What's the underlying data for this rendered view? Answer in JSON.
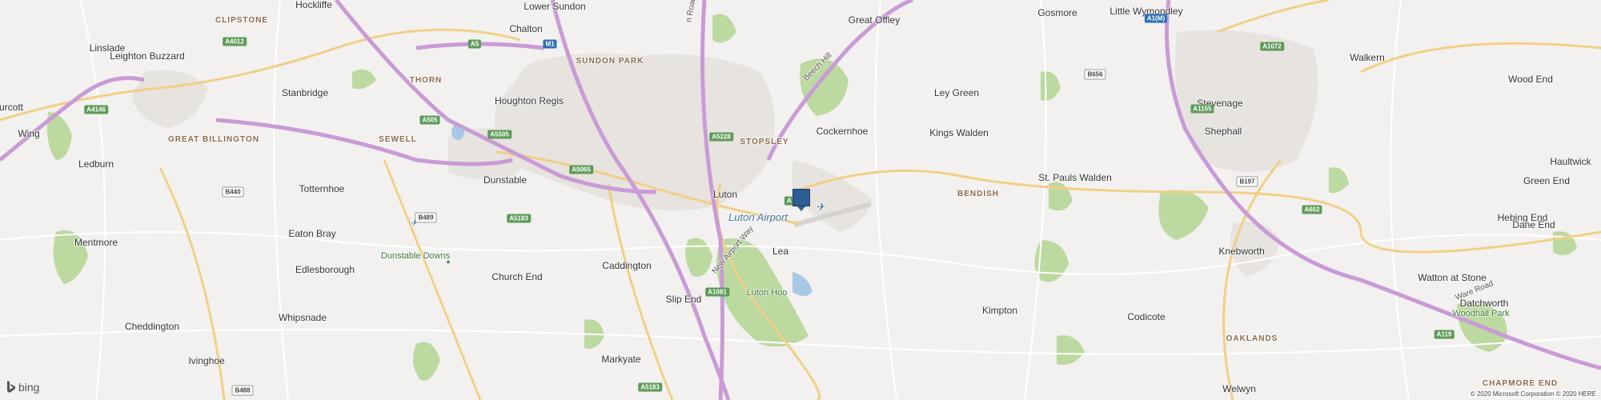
{
  "map": {
    "attribution": "© 2020 Microsoft Corporation © 2020 HERE",
    "brand": "bing",
    "colors": {
      "background": "#f2f1ef",
      "motorway": "#c99bd6",
      "a_road": "#f3d58d",
      "minor_road": "#ffffff",
      "urban": "#e6e2de",
      "woodland": "#b7d79a",
      "water": "#a9c8e8",
      "pin": "#2d5d94"
    },
    "pin_icon": "location-marker",
    "place_labels": [
      {
        "text": "Hockliffe"
      },
      {
        "text": "Lower Sundon"
      },
      {
        "text": "Great Offley"
      },
      {
        "text": "Gosmore"
      },
      {
        "text": "Little Wymondley"
      },
      {
        "text": "Linslade"
      },
      {
        "text": "Leighton Buzzard"
      },
      {
        "text": "Chalton"
      },
      {
        "text": "Stanbridge"
      },
      {
        "text": "Houghton Regis"
      },
      {
        "text": "Ley Green"
      },
      {
        "text": "Walkern"
      },
      {
        "text": "Wood End"
      },
      {
        "text": "urcott"
      },
      {
        "text": "Wing"
      },
      {
        "text": "Cockernhoe"
      },
      {
        "text": "Kings Walden"
      },
      {
        "text": "Stevenage"
      },
      {
        "text": "Shephall"
      },
      {
        "text": "Haultwick"
      },
      {
        "text": "Ledburn"
      },
      {
        "text": "Totternhoe"
      },
      {
        "text": "Dunstable"
      },
      {
        "text": "Luton"
      },
      {
        "text": "St. Pauls Walden"
      },
      {
        "text": "Green End"
      },
      {
        "text": "Eaton Bray"
      },
      {
        "text": "Hebing End"
      },
      {
        "text": "Dane End"
      },
      {
        "text": "Mentmore"
      },
      {
        "text": "Caddington"
      },
      {
        "text": "Lea"
      },
      {
        "text": "Knebworth"
      },
      {
        "text": "Edlesborough"
      },
      {
        "text": "Church End"
      },
      {
        "text": "Slip End"
      },
      {
        "text": "Watton at Stone"
      },
      {
        "text": "Datchworth"
      },
      {
        "text": "Kimpton"
      },
      {
        "text": "Codicote"
      },
      {
        "text": "Whipsnade"
      },
      {
        "text": "Cheddington"
      },
      {
        "text": "Markyate"
      },
      {
        "text": "Ivinghoe"
      },
      {
        "text": "Welwyn"
      }
    ],
    "district_labels": [
      {
        "text": "CLIPSTONE"
      },
      {
        "text": "SUNDON PARK"
      },
      {
        "text": "THORN"
      },
      {
        "text": "STOPSLEY"
      },
      {
        "text": "GREAT BILLINGTON"
      },
      {
        "text": "SEWELL"
      },
      {
        "text": "BENDISH"
      },
      {
        "text": "OAKLANDS"
      },
      {
        "text": "CHAPMORE END"
      }
    ],
    "green_labels": [
      {
        "text": "Dunstable Downs"
      },
      {
        "text": "Luton Hoo"
      },
      {
        "text": "Woodhall Park"
      }
    ],
    "airport_label": "Luton Airport",
    "road_labels": [
      {
        "text": "Beech Hill"
      },
      {
        "text": "New Airport Way"
      },
      {
        "text": "Ware Road"
      },
      {
        "text": "n Road"
      }
    ],
    "road_shields": [
      {
        "text": "A4012",
        "style": "green"
      },
      {
        "text": "A5",
        "style": "green"
      },
      {
        "text": "M1",
        "style": "blue"
      },
      {
        "text": "A1(M)",
        "style": "blue"
      },
      {
        "text": "A1072",
        "style": "green"
      },
      {
        "text": "B656",
        "style": "white"
      },
      {
        "text": "A4146",
        "style": "green"
      },
      {
        "text": "A505",
        "style": "green"
      },
      {
        "text": "A5505",
        "style": "green"
      },
      {
        "text": "A5228",
        "style": "green"
      },
      {
        "text": "A1155",
        "style": "green"
      },
      {
        "text": "B440",
        "style": "white"
      },
      {
        "text": "A5065",
        "style": "green"
      },
      {
        "text": "B197",
        "style": "white"
      },
      {
        "text": "B489",
        "style": "white"
      },
      {
        "text": "A5183",
        "style": "green"
      },
      {
        "text": "A602",
        "style": "green"
      },
      {
        "text": "A1081",
        "style": "green"
      },
      {
        "text": "A119",
        "style": "green"
      },
      {
        "text": "B488",
        "style": "white"
      },
      {
        "text": "A5183",
        "style": "green"
      },
      {
        "text": "A1",
        "style": "green"
      }
    ]
  }
}
